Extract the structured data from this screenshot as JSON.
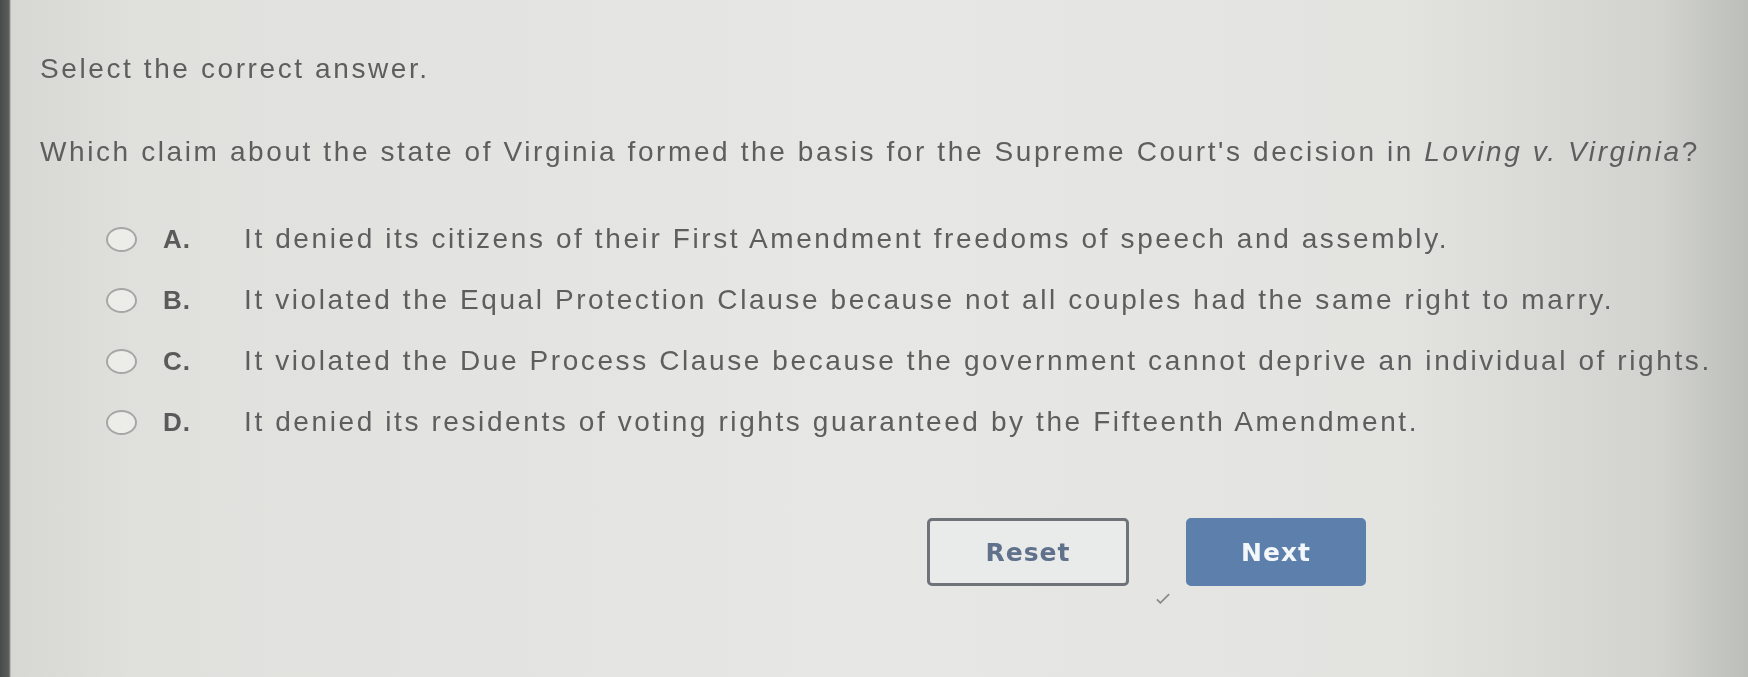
{
  "instruction": "Select the correct answer.",
  "question": "Which claim about the state of Virginia formed the basis for the Supreme Court's decision in *Loving v. Virginia*?",
  "options": [
    {
      "letter": "A.",
      "text": "It denied its citizens of their First Amendment freedoms of speech and assembly.",
      "selected": false
    },
    {
      "letter": "B.",
      "text": "It violated the Equal Protection Clause because not all couples had the same right to marry.",
      "selected": false
    },
    {
      "letter": "C.",
      "text": "It violated the Due Process Clause because the government cannot deprive an individual of rights.",
      "selected": false
    },
    {
      "letter": "D.",
      "text": "It denied its residents of voting rights guaranteed by the Fifteenth Amendment.",
      "selected": false
    }
  ],
  "buttons": [
    {
      "label": "Reset",
      "kind": "secondary"
    },
    {
      "label": "Next",
      "kind": "primary"
    }
  ]
}
